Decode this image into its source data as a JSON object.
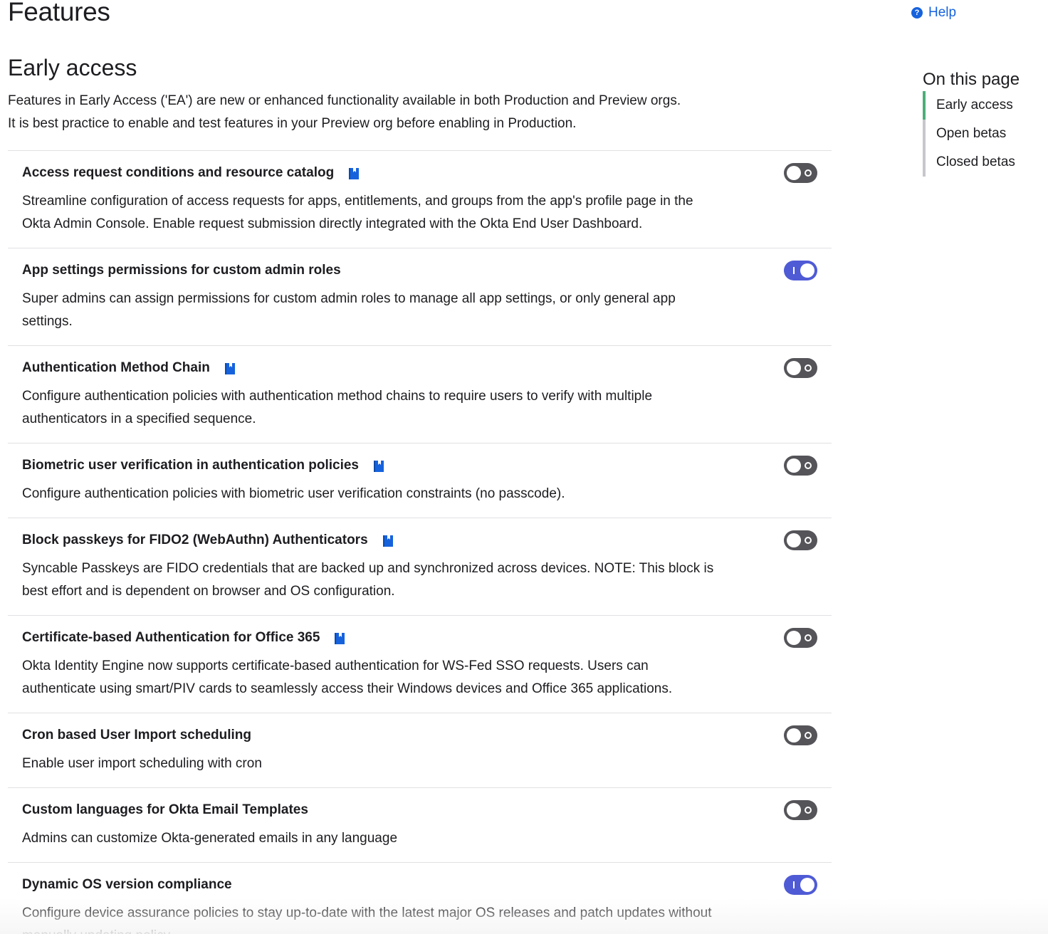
{
  "header": {
    "title": "Features",
    "help_label": "Help",
    "help_icon": "question-circle-icon"
  },
  "section": {
    "title": "Early access",
    "description_lines": [
      "Features in Early Access ('EA') are new or enhanced functionality available in both Production and Preview orgs.",
      "It is best practice to enable and test features in your Preview org before enabling in Production."
    ]
  },
  "features": [
    {
      "name": "Access request conditions and resource catalog",
      "has_doc_icon": true,
      "enabled": false,
      "description": "Streamline configuration of access requests for apps, entitlements, and groups from the app's profile page in the Okta Admin Console. Enable request submission directly integrated with the Okta End User Dashboard."
    },
    {
      "name": "App settings permissions for custom admin roles",
      "has_doc_icon": false,
      "enabled": true,
      "description": "Super admins can assign permissions for custom admin roles to manage all app settings, or only general app settings."
    },
    {
      "name": "Authentication Method Chain",
      "has_doc_icon": true,
      "enabled": false,
      "description": "Configure authentication policies with authentication method chains to require users to verify with multiple authenticators in a specified sequence."
    },
    {
      "name": "Biometric user verification in authentication policies",
      "has_doc_icon": true,
      "enabled": false,
      "description": "Configure authentication policies with biometric user verification constraints (no passcode)."
    },
    {
      "name": "Block passkeys for FIDO2 (WebAuthn) Authenticators",
      "has_doc_icon": true,
      "enabled": false,
      "description": "Syncable Passkeys are FIDO credentials that are backed up and synchronized across devices. NOTE: This block is best effort and is dependent on browser and OS configuration."
    },
    {
      "name": "Certificate-based Authentication for Office 365",
      "has_doc_icon": true,
      "enabled": false,
      "description": "Okta Identity Engine now supports certificate-based authentication for WS-Fed SSO requests. Users can authenticate using smart/PIV cards to seamlessly access their Windows devices and Office 365 applications."
    },
    {
      "name": "Cron based User Import scheduling",
      "has_doc_icon": false,
      "enabled": false,
      "description": "Enable user import scheduling with cron"
    },
    {
      "name": "Custom languages for Okta Email Templates",
      "has_doc_icon": false,
      "enabled": false,
      "description": "Admins can customize Okta-generated emails in any language"
    },
    {
      "name": "Dynamic OS version compliance",
      "has_doc_icon": false,
      "enabled": true,
      "description": "Configure device assurance policies to stay up-to-date with the latest major OS releases and patch updates without manually updating policy."
    }
  ],
  "toc": {
    "title": "On this page",
    "items": [
      {
        "label": "Early access",
        "active": true
      },
      {
        "label": "Open betas",
        "active": false
      },
      {
        "label": "Closed betas",
        "active": false
      }
    ]
  },
  "colors": {
    "toggle_on": "#4f5bd5",
    "toggle_off": "#545459",
    "link": "#1662dd",
    "toc_active": "#4cae79",
    "doc_icon": "#1662dd"
  }
}
